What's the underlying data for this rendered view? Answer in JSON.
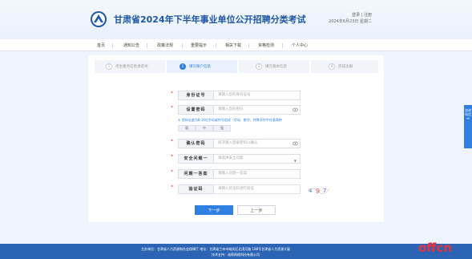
{
  "header": {
    "title": "甘肃省2024年下半年事业单位公开招聘分类考试",
    "links": {
      "login": "登录",
      "register": "注册"
    },
    "date": "2024年6月23日 星期二"
  },
  "nav": {
    "items": [
      "首页",
      "通知公告",
      "政策法规",
      "重要提示",
      "相关下载",
      "资格检测",
      "个人中心"
    ]
  },
  "steps": [
    {
      "num": "1",
      "label": "考生服务信息承诺书"
    },
    {
      "num": "2",
      "label": "填写账户信息"
    },
    {
      "num": "3",
      "label": "填写基本信息"
    },
    {
      "num": "4",
      "label": "完成注册"
    }
  ],
  "form": {
    "id_label": "身份证号",
    "id_placeholder": "请输入您的身份证号",
    "pwd_label": "设置密码",
    "pwd_placeholder": "请输入您的密码",
    "pwd_hint": "① 密码长度为8-16位字母或符号组成（字母、数字、特殊字符中任意两种",
    "strength": [
      "弱",
      "中",
      "强"
    ],
    "confirm_label": "确认密码",
    "confirm_placeholder": "再次输入登录密码以确认",
    "question_label": "安全问题一",
    "question_placeholder": "请选择安全问题",
    "answer_label": "问题一答案",
    "answer_placeholder": "请输入问题一答案",
    "captcha_label": "验证码",
    "captcha_placeholder": "请输入验证码进行验证",
    "captcha_text": "4 9 7"
  },
  "buttons": {
    "next": "下一步",
    "prev": "上一步"
  },
  "side_tab": "咨询电话 ≪",
  "footer": {
    "line1": "主办单位：甘肃省人力资源和社会保障厅   地址：甘肃省兰州市城关区北滨河路 188号甘肃省人力资源大厦",
    "line2": "技术支持：诚帮网络科技有限公司"
  },
  "watermark": "offcn",
  "colors": {
    "accent": "#2e7fe0",
    "footer": "#2b64b5",
    "required": "#e23a3a",
    "watermark": "#e8313b"
  }
}
